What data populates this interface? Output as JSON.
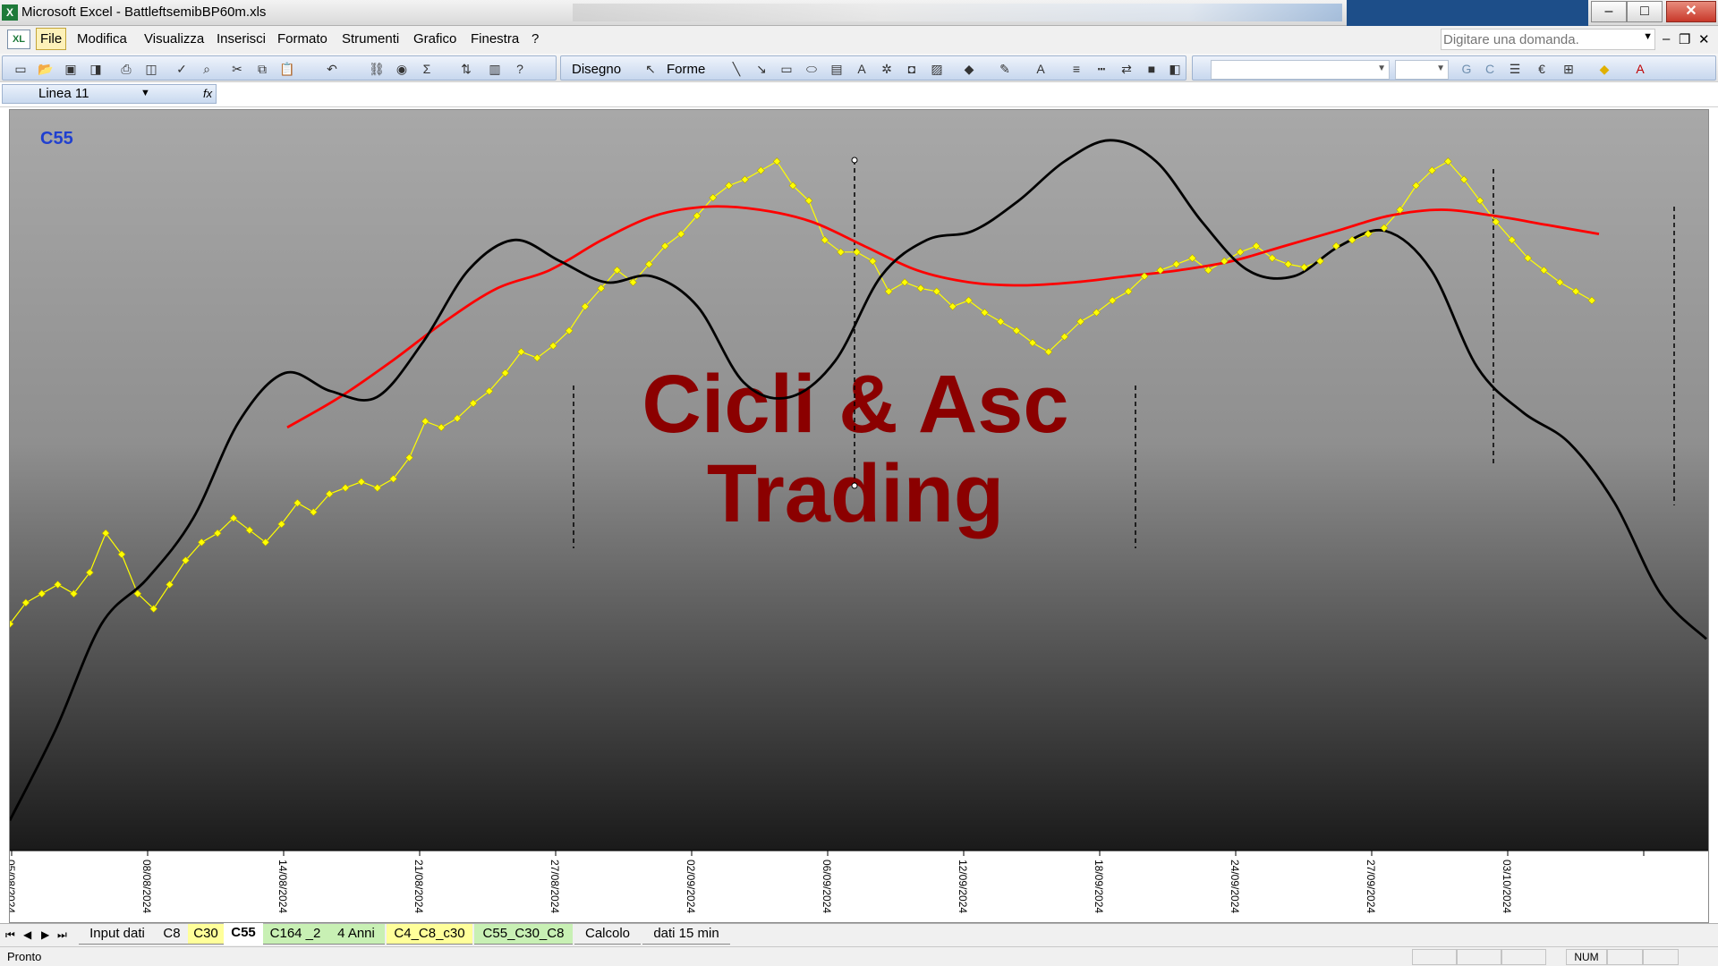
{
  "window": {
    "title": "Microsoft Excel - BattleftsemibBP60m.xls",
    "controls": [
      "–",
      "□",
      "✕"
    ]
  },
  "menu": {
    "items": [
      "File",
      "Modifica",
      "Visualizza",
      "Inserisci",
      "Formato",
      "Strumenti",
      "Grafico",
      "Finestra",
      "?"
    ],
    "question_placeholder": "Digitare una domanda.",
    "mdi_controls": [
      "–",
      "❐",
      "✕"
    ]
  },
  "toolbar": {
    "disegno_label": "Disegno",
    "forme_label": "Forme",
    "icons": [
      "new-icon",
      "open-icon",
      "save-icon",
      "permission-icon",
      "print-icon",
      "print-preview-icon",
      "spelling-icon",
      "research-icon",
      "cut-icon",
      "copy-icon",
      "paste-icon",
      "undo-icon",
      "hyperlink-icon",
      "web-icon",
      "autosum-icon",
      "sort-icon",
      "chart-wizard-icon",
      "help-icon",
      "select-objects-icon",
      "line-icon",
      "arrow-icon",
      "rectangle-icon",
      "oval-icon",
      "textbox-icon",
      "wordart-icon",
      "diagram-icon",
      "clipart-icon",
      "picture-icon",
      "fill-color-icon",
      "line-color-icon",
      "font-color-icon",
      "line-style-icon",
      "dash-style-icon",
      "arrow-style-icon",
      "shadow-icon",
      "3d-icon",
      "bold-icon",
      "italic-icon",
      "align-icon",
      "euro-icon",
      "borders-icon"
    ],
    "bold_label": "G",
    "italic_label": "C"
  },
  "formula_bar": {
    "name_box": "Linea 11",
    "fx": "fx"
  },
  "chart_data": {
    "type": "line",
    "sheet_label": "C55",
    "watermark": [
      "Cicli & Asc",
      "Trading"
    ],
    "x_tick_labels": [
      "05/08/2024",
      "08/08/2024",
      "14/08/2024",
      "21/08/2024",
      "27/08/2024",
      "02/09/2024",
      "06/09/2024",
      "12/09/2024",
      "18/09/2024",
      "24/09/2024",
      "27/09/2024",
      "03/10/2024",
      ""
    ],
    "grid": false,
    "series": [
      {
        "color": "#ffff00",
        "marker": "diamond",
        "values": [
          0.45,
          0.52,
          0.55,
          0.58,
          0.55,
          0.62,
          0.75,
          0.68,
          0.55,
          0.5,
          0.58,
          0.66,
          0.72,
          0.75,
          0.8,
          0.76,
          0.72,
          0.78,
          0.85,
          0.82,
          0.88,
          0.9,
          0.92,
          0.9,
          0.93,
          1.0,
          1.12,
          1.1,
          1.13,
          1.18,
          1.22,
          1.28,
          1.35,
          1.33,
          1.37,
          1.42,
          1.5,
          1.56,
          1.62,
          1.58,
          1.64,
          1.7,
          1.74,
          1.8,
          1.86,
          1.9,
          1.92,
          1.95,
          1.98,
          1.9,
          1.85,
          1.72,
          1.68,
          1.68,
          1.65,
          1.55,
          1.58,
          1.56,
          1.55,
          1.5,
          1.52,
          1.48,
          1.45,
          1.42,
          1.38,
          1.35,
          1.4,
          1.45,
          1.48,
          1.52,
          1.55,
          1.6,
          1.62,
          1.64,
          1.66,
          1.62,
          1.65,
          1.68,
          1.7,
          1.66,
          1.64,
          1.63,
          1.65,
          1.7,
          1.72,
          1.74,
          1.76,
          1.82,
          1.9,
          1.95,
          1.98,
          1.92,
          1.85,
          1.78,
          1.72,
          1.66,
          1.62,
          1.58,
          1.55,
          1.52
        ]
      },
      {
        "color": "#ff0000",
        "values": [
          1.1,
          1.2,
          1.32,
          1.45,
          1.56,
          1.62,
          1.72,
          1.8,
          1.83,
          1.82,
          1.78,
          1.7,
          1.62,
          1.58,
          1.57,
          1.58,
          1.6,
          1.62,
          1.65,
          1.7,
          1.75,
          1.8,
          1.82,
          1.8,
          1.77,
          1.74
        ]
      },
      {
        "color": "#000000",
        "values": [
          -0.2,
          0.1,
          0.45,
          0.6,
          0.8,
          1.12,
          1.28,
          1.22,
          1.2,
          1.38,
          1.62,
          1.72,
          1.65,
          1.58,
          1.6,
          1.5,
          1.25,
          1.2,
          1.32,
          1.6,
          1.72,
          1.75,
          1.85,
          1.98,
          2.05,
          1.98,
          1.78,
          1.62,
          1.6,
          1.7,
          1.75,
          1.62,
          1.3,
          1.15,
          1.05,
          0.85,
          0.55,
          0.4
        ]
      }
    ],
    "vertical_markers": [
      "solid-handle at 06/09/2024",
      "dashed",
      "dashed",
      "dashed",
      "dashed"
    ]
  },
  "sheet_tabs": {
    "nav": [
      "⏮",
      "◀",
      "▶",
      "⏭"
    ],
    "items": [
      "Input dati",
      "C8",
      "C30",
      "C55",
      "C164 _2",
      "4 Anni",
      "C4_C8_c30",
      "C55_C30_C8",
      "Calcolo",
      "dati 15 min"
    ],
    "active": "C55"
  },
  "status_bar": {
    "text": "Pronto",
    "num": "NUM"
  }
}
